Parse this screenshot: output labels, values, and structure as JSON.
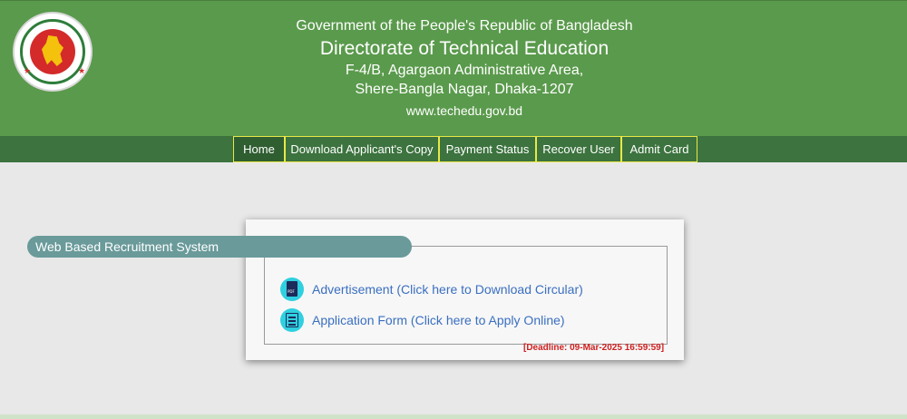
{
  "header": {
    "line1": "Government of the People's Republic of Bangladesh",
    "title": "Directorate of Technical Education",
    "address1": "F-4/B, Agargaon Administrative Area,",
    "address2": "Shere-Bangla Nagar, Dhaka-1207",
    "website": "www.techedu.gov.bd",
    "logo_icon": "bangladesh-government-seal"
  },
  "nav": {
    "items": [
      {
        "label": "Home",
        "active": true
      },
      {
        "label": "Download Applicant's Copy",
        "active": false
      },
      {
        "label": "Payment Status",
        "active": false
      },
      {
        "label": "Recover User",
        "active": false
      },
      {
        "label": "Admit Card",
        "active": false
      }
    ]
  },
  "panel": {
    "legend": "Web Based Recruitment System",
    "links": [
      {
        "label": "Advertisement (Click here to Download Circular)",
        "icon": "pdf-icon"
      },
      {
        "label": "Application Form (Click here to Apply Online)",
        "icon": "form-icon"
      }
    ],
    "deadline": "[Deadline: 09-Mar-2025 16:59:59]"
  },
  "colors": {
    "header_bg": "#5a9a4c",
    "nav_bg": "#3c733e",
    "nav_border": "#e8e848",
    "legend_bg": "#6a9a9a",
    "link": "#3a6fc0",
    "deadline": "#d02020"
  }
}
